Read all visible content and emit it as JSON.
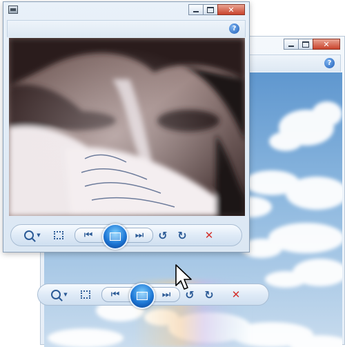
{
  "back_window": {
    "toolbar": {
      "prev_icon": "skip-previous-icon",
      "slideshow_icon": "slideshow-icon",
      "next_icon": "skip-next-icon",
      "delete_glyph": "✕"
    },
    "help_glyph": "?"
  },
  "front_window": {
    "help_glyph": "?",
    "toolbar": {
      "zoom_icon": "zoom-icon",
      "delete_glyph": "✕"
    }
  },
  "caption": {
    "close_glyph": "✕"
  },
  "colors": {
    "accent": "#1e78d6",
    "delete": "#d3302b",
    "toolbar_icon": "#2b5a96"
  }
}
